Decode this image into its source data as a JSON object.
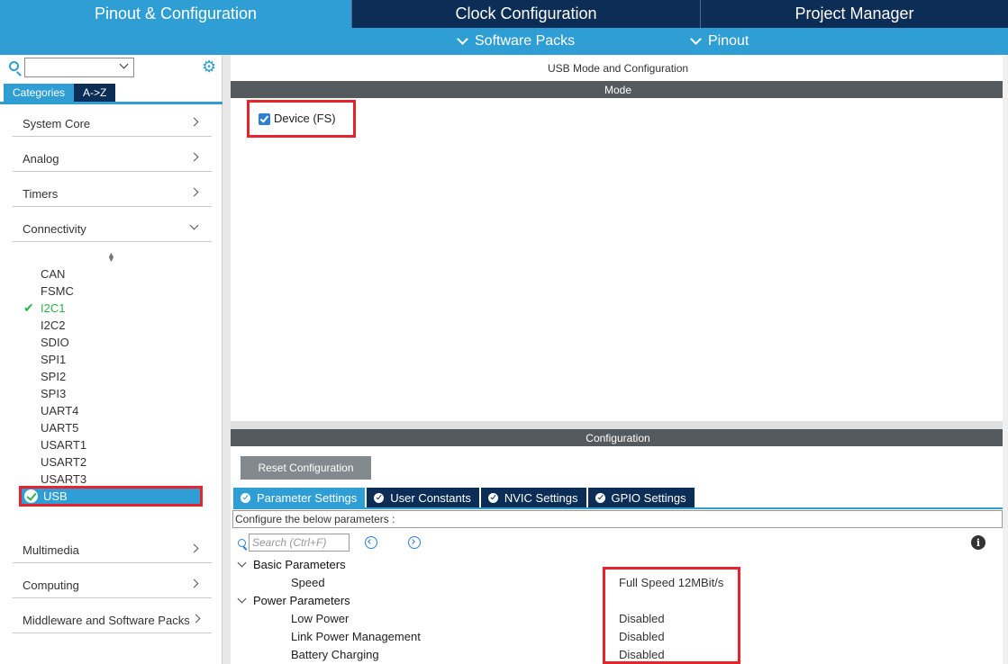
{
  "main_tabs": [
    {
      "label": "Pinout & Configuration",
      "active": true
    },
    {
      "label": "Clock Configuration",
      "active": false
    },
    {
      "label": "Project Manager",
      "active": false
    }
  ],
  "sub_menu": [
    {
      "label": "Software Packs",
      "icon": "chevron-down-icon"
    },
    {
      "label": "Pinout",
      "icon": "chevron-down-icon"
    }
  ],
  "left_panel": {
    "search_value": "",
    "category_tabs": [
      {
        "label": "Categories",
        "active": true
      },
      {
        "label": "A->Z",
        "active": false
      }
    ],
    "categories": [
      {
        "label": "System Core",
        "expanded": false
      },
      {
        "label": "Analog",
        "expanded": false
      },
      {
        "label": "Timers",
        "expanded": false
      },
      {
        "label": "Connectivity",
        "expanded": true
      },
      {
        "label": "Multimedia",
        "expanded": false
      },
      {
        "label": "Computing",
        "expanded": false
      },
      {
        "label": "Middleware and Software Packs",
        "expanded": false
      }
    ],
    "connectivity_items": [
      {
        "label": "CAN",
        "status": "none"
      },
      {
        "label": "FSMC",
        "status": "none"
      },
      {
        "label": "I2C1",
        "status": "configured"
      },
      {
        "label": "I2C2",
        "status": "none"
      },
      {
        "label": "SDIO",
        "status": "none"
      },
      {
        "label": "SPI1",
        "status": "none"
      },
      {
        "label": "SPI2",
        "status": "none"
      },
      {
        "label": "SPI3",
        "status": "none"
      },
      {
        "label": "UART4",
        "status": "none"
      },
      {
        "label": "UART5",
        "status": "none"
      },
      {
        "label": "USART1",
        "status": "none"
      },
      {
        "label": "USART2",
        "status": "none"
      },
      {
        "label": "USART3",
        "status": "none"
      },
      {
        "label": "USB",
        "status": "configured-selected"
      }
    ]
  },
  "right_panel": {
    "title": "USB Mode and Configuration",
    "mode_header": "Mode",
    "mode_checkbox": {
      "label": "Device (FS)",
      "checked": true
    },
    "config_header": "Configuration",
    "reset_button": "Reset Configuration",
    "param_tabs": [
      {
        "label": "Parameter Settings",
        "active": true
      },
      {
        "label": "User Constants",
        "active": false
      },
      {
        "label": "NVIC Settings",
        "active": false
      },
      {
        "label": "GPIO Settings",
        "active": false
      }
    ],
    "configure_text": "Configure the below parameters :",
    "search_placeholder": "Search (Ctrl+F)",
    "groups": [
      {
        "label": "Basic Parameters",
        "params": [
          {
            "name": "Speed",
            "value": "Full Speed 12MBit/s"
          }
        ]
      },
      {
        "label": "Power Parameters",
        "params": [
          {
            "name": "Low Power",
            "value": "Disabled"
          },
          {
            "name": "Link Power Management",
            "value": "Disabled"
          },
          {
            "name": "Battery Charging",
            "value": "Disabled"
          }
        ]
      }
    ]
  },
  "colors": {
    "accent_blue": "#2f9ed4",
    "navy": "#0c2d56",
    "highlight_red": "#e8232b",
    "configured_green": "#2db34a",
    "header_gray": "#555a5e"
  }
}
